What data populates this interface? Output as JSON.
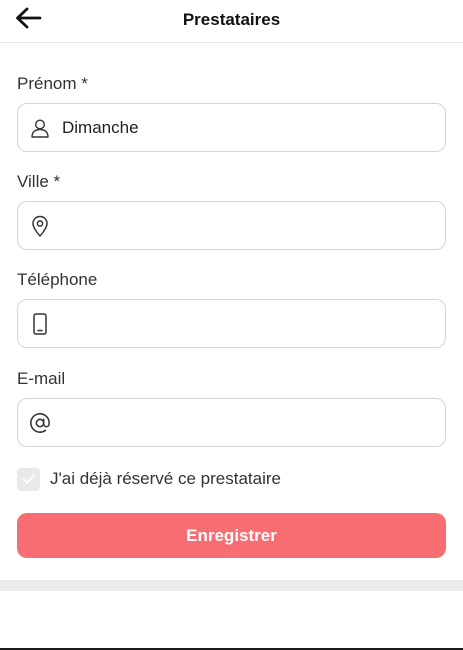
{
  "header": {
    "title": "Prestataires",
    "back_icon": "arrow-left-icon"
  },
  "form": {
    "fields": [
      {
        "label": "Prénom *",
        "value": "Dimanche",
        "icon": "user-icon"
      },
      {
        "label": "Ville *",
        "value": "",
        "icon": "map-pin-icon"
      },
      {
        "label": "Téléphone",
        "value": "",
        "icon": "smartphone-icon"
      },
      {
        "label": "E-mail",
        "value": "",
        "icon": "at-sign-icon"
      }
    ],
    "checkbox": {
      "label": "J'ai déjà réservé ce prestataire",
      "checked": true
    },
    "save_label": "Enregistrer"
  },
  "colors": {
    "accent": "#f76e72",
    "border": "#d5d5d5",
    "checkbox_bg": "#e9e9e9"
  }
}
